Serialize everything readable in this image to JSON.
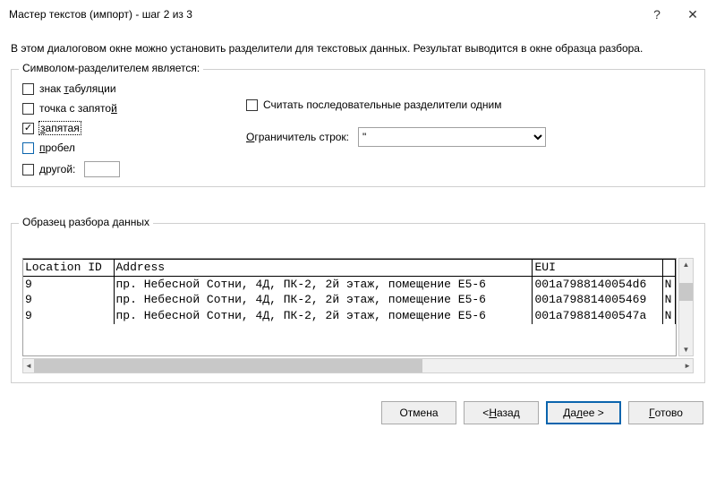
{
  "titlebar": {
    "title": "Мастер текстов (импорт) - шаг 2 из 3",
    "help": "?",
    "close": "✕"
  },
  "description": "В этом диалоговом окне можно установить разделители для текстовых данных. Результат выводится в окне образца разбора.",
  "delimGroup": {
    "legend": "Символом-разделителем является:",
    "tab": "знак табуляции",
    "semicolon": "точка с запятой",
    "comma": "запятая",
    "space": "пробел",
    "other": "другой:",
    "treatConsecutive": "Считать последовательные разделители одним",
    "qualifierLabel": "Ограничитель строк:",
    "qualifierValue": "\""
  },
  "previewGroup": {
    "legend": "Образец разбора данных"
  },
  "preview": {
    "headers": [
      "Location ID",
      "Address",
      "EUI",
      ""
    ],
    "rows": [
      [
        "9",
        "пр. Небесной Сотни, 4Д, ПК-2, 2й этаж, помещение E5-6",
        "001a7988140054d6",
        "N"
      ],
      [
        "9",
        "пр. Небесной Сотни, 4Д, ПК-2, 2й этаж, помещение E5-6",
        "001a798814005469",
        "N"
      ],
      [
        "9",
        "пр. Небесной Сотни, 4Д, ПК-2, 2й этаж, помещение E5-6",
        "001a79881400547a",
        "N"
      ]
    ]
  },
  "buttons": {
    "cancel": "Отмена",
    "back": "< Назад",
    "next": "Далее >",
    "finish": "Готово"
  }
}
